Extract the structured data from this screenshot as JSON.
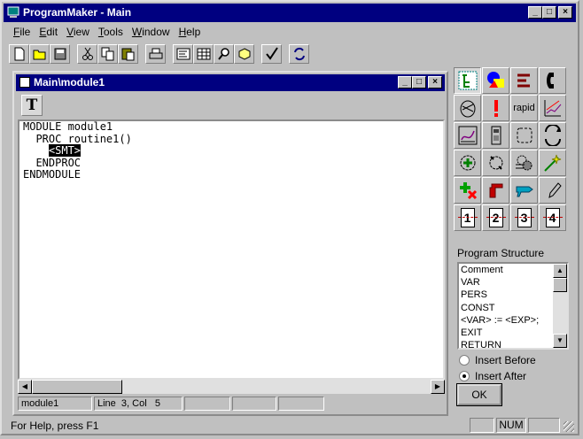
{
  "app": {
    "title": "ProgramMaker - Main",
    "menu": [
      "File",
      "Edit",
      "View",
      "Tools",
      "Window",
      "Help"
    ],
    "menu_accel": [
      "F",
      "E",
      "V",
      "T",
      "W",
      "H"
    ]
  },
  "toolbar": {
    "buttons": [
      "new-icon",
      "open-icon",
      "save-icon",
      "cut-icon",
      "copy-icon",
      "paste-icon",
      "print-icon",
      "form-view-icon",
      "table-view-icon",
      "find-icon",
      "object-icon",
      "check-icon",
      "sync-icon"
    ]
  },
  "child": {
    "title": "Main\\module1",
    "text_tool": "T",
    "code_lines": [
      "MODULE module1",
      "  PROC routine1()",
      "    <SMT>",
      "  ENDPROC",
      "ENDMODULE"
    ],
    "selected_token": "<SMT>",
    "status": {
      "module": "module1",
      "line_label": "Line",
      "line": "3",
      "col_label": "Col",
      "col": "5"
    }
  },
  "palette": {
    "rapid_label": "rapid",
    "numbers": [
      "1",
      "2",
      "3",
      "4"
    ],
    "icons": [
      "tree-icon",
      "shapes-icon",
      "align-icon",
      "call-icon",
      "mouse-icon",
      "exclamation-icon",
      "rapid-button",
      "graph-icon",
      "curve-icon",
      "device-icon",
      "selection-icon",
      "refresh-icon",
      "plus-gear-icon",
      "gear-refresh-icon",
      "gears-icon",
      "sparkle-icon",
      "add-remove-icon",
      "robot-arm-icon",
      "drill-icon",
      "pencil-icon"
    ]
  },
  "program_structure": {
    "label": "Program Structure",
    "items": [
      "Comment",
      "VAR",
      "PERS",
      "CONST",
      "<VAR> := <EXP>;",
      "EXIT",
      "RETURN"
    ],
    "insert_before": "Insert Before",
    "insert_after": "Insert After",
    "selected_option": "insert_after",
    "ok_label": "OK"
  },
  "statusbar": {
    "message": "For Help, press F1",
    "num": "NUM"
  }
}
